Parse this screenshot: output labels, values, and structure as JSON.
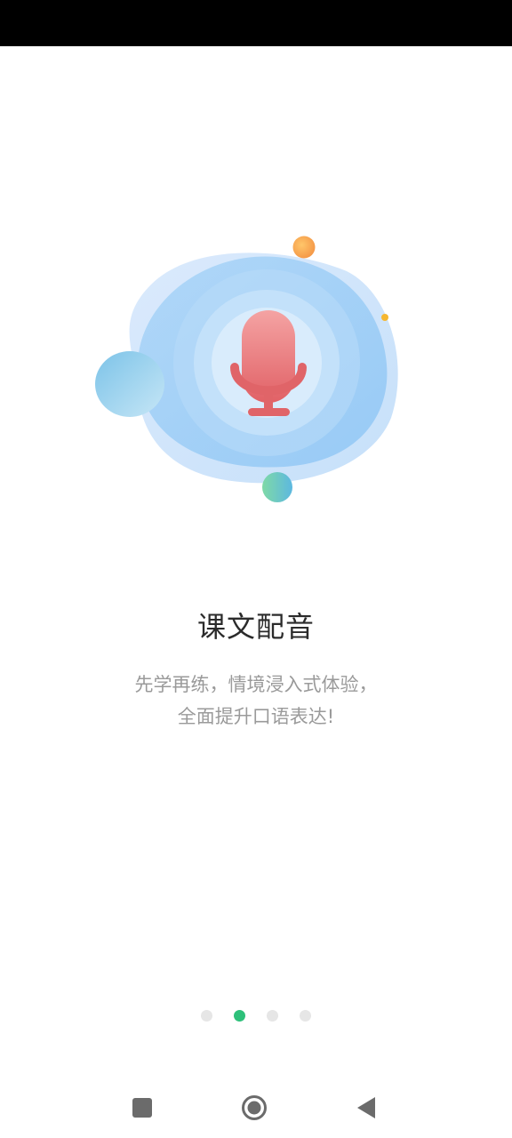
{
  "onboarding": {
    "title": "课文配音",
    "subtitle_line1": "先学再练，情境浸入式体验，",
    "subtitle_line2": "全面提升口语表达!",
    "illustration_icon": "microphone-icon",
    "page_count": 4,
    "active_page": 2
  },
  "navigation": {
    "recent_icon": "square-icon",
    "home_icon": "circle-home-icon",
    "back_icon": "triangle-back-icon"
  },
  "colors": {
    "accent": "#2ec07a",
    "inactive_dot": "#e6e6e6",
    "mic": "#e06468",
    "blob": "#a9d4f7"
  }
}
